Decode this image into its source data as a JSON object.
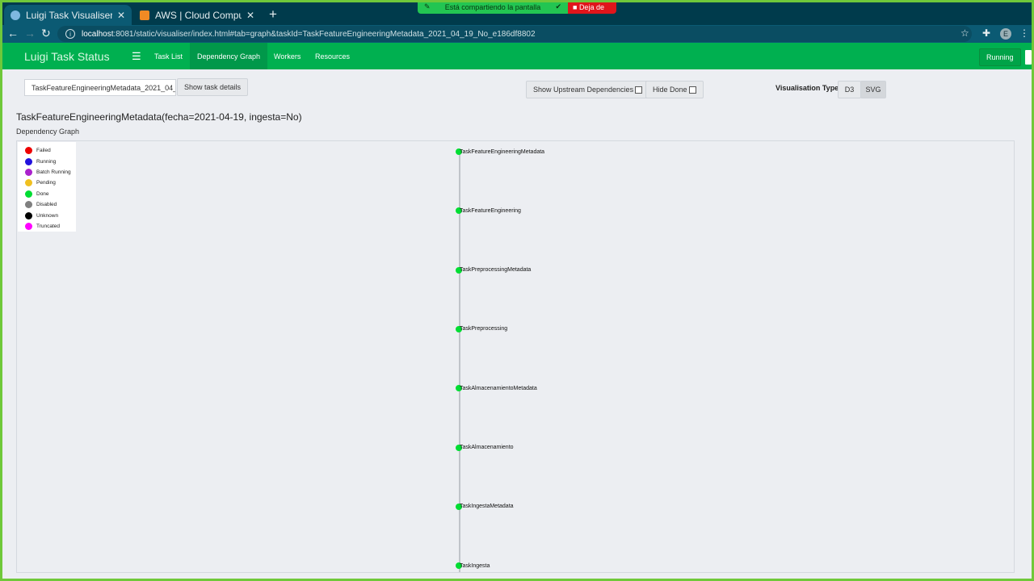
{
  "browser": {
    "tabs": [
      {
        "title": "Luigi Task Visualiser",
        "active": true
      },
      {
        "title": "AWS | Cloud Computing - Serv",
        "active": false
      }
    ],
    "share_text": "Está compartiendo la pantalla",
    "stop_text": "Deja de",
    "url_host": "localhost",
    "url_rest": ":8081/static/visualiser/index.html#tab=graph&taskId=TaskFeatureEngineeringMetadata_2021_04_19_No_e186df8802",
    "profile_initial": "E"
  },
  "app": {
    "brand": "Luigi Task Status",
    "nav": [
      {
        "label": "Task List",
        "active": false
      },
      {
        "label": "Dependency Graph",
        "active": true
      },
      {
        "label": "Workers",
        "active": false
      },
      {
        "label": "Resources",
        "active": false
      }
    ],
    "running_label": "Running"
  },
  "controls": {
    "task_input_value": "TaskFeatureEngineeringMetadata_2021_04_",
    "show_details_label": "Show task details",
    "upstream_label": "Show Upstream Dependencies",
    "hide_done_label": "Hide Done",
    "vis_type_label": "Visualisation Type",
    "vis_d3": "D3",
    "vis_svg": "SVG"
  },
  "graph": {
    "heading": "TaskFeatureEngineeringMetadata(fecha=2021-04-19, ingesta=No)",
    "subheading": "Dependency Graph",
    "legend": [
      {
        "label": "Failed",
        "color": "#ee0000"
      },
      {
        "label": "Running",
        "color": "#2211dd"
      },
      {
        "label": "Batch Running",
        "color": "#aa22cc"
      },
      {
        "label": "Pending",
        "color": "#f0c020"
      },
      {
        "label": "Done",
        "color": "#00dd33"
      },
      {
        "label": "Disabled",
        "color": "#808080"
      },
      {
        "label": "Unknown",
        "color": "#000000"
      },
      {
        "label": "Truncated",
        "color": "#ff00ff"
      }
    ],
    "nodes": [
      {
        "label": "TaskFeatureEngineeringMetadata",
        "status": "Done"
      },
      {
        "label": "TaskFeatureEngineering",
        "status": "Done"
      },
      {
        "label": "TaskPreprocessingMetadata",
        "status": "Done"
      },
      {
        "label": "TaskPreprocessing",
        "status": "Done"
      },
      {
        "label": "TaskAlmacenamientoMetadata",
        "status": "Done"
      },
      {
        "label": "TaskAlmacenamiento",
        "status": "Done"
      },
      {
        "label": "TaskIngestaMetadata",
        "status": "Done"
      },
      {
        "label": "TaskIngesta",
        "status": "Done"
      }
    ]
  }
}
